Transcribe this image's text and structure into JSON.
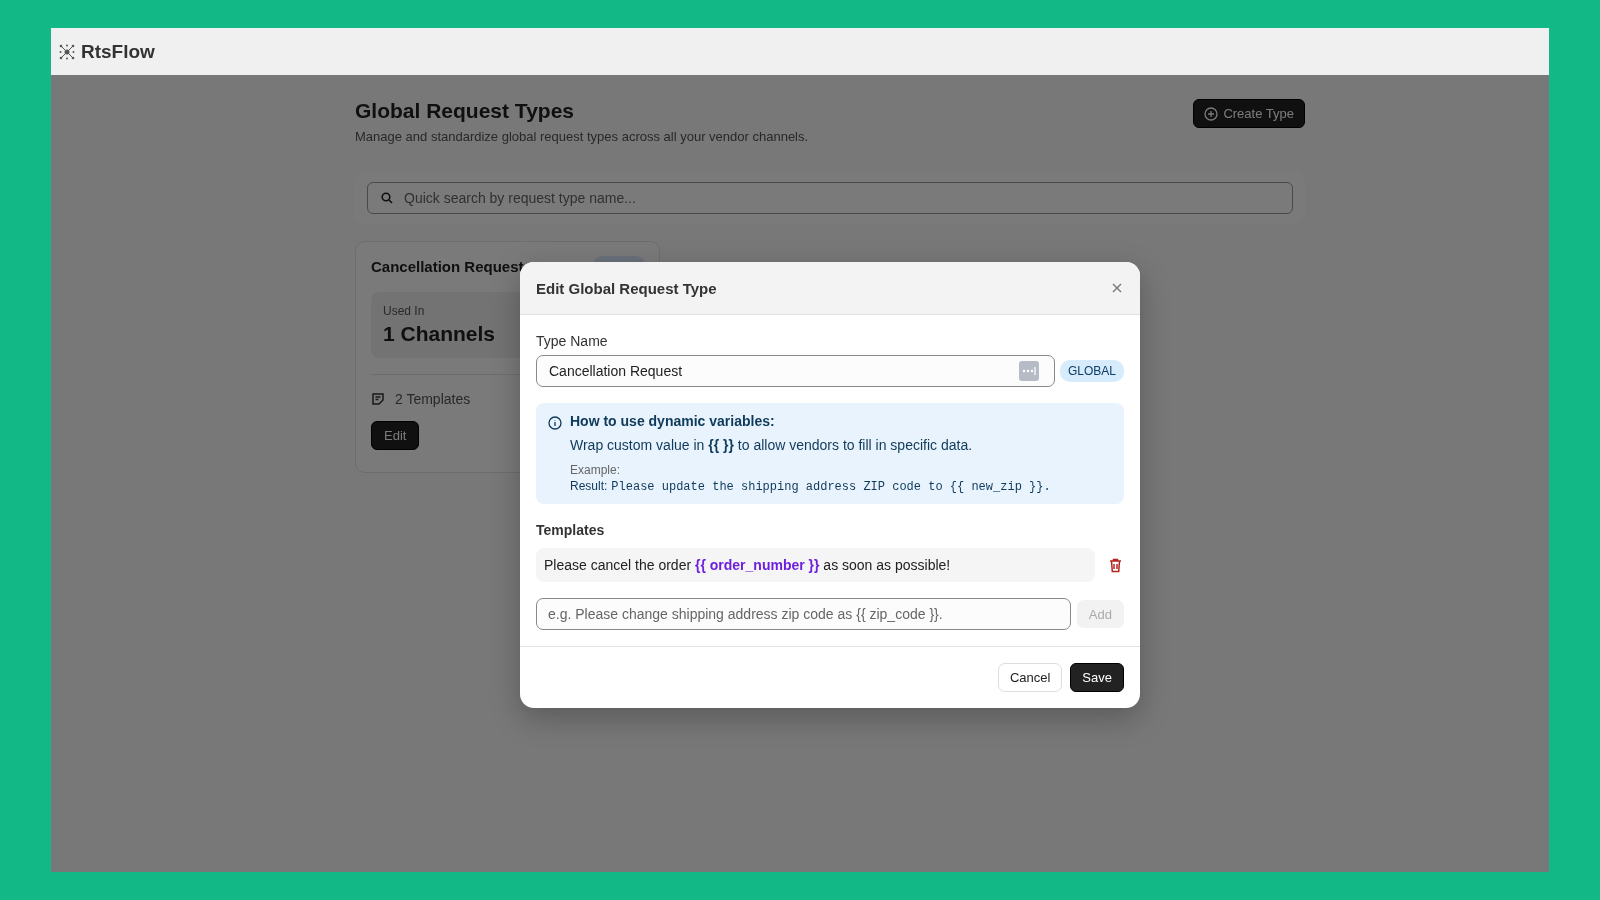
{
  "app": {
    "name": "RtsFlow"
  },
  "page": {
    "title": "Global Request Types",
    "subtitle": "Manage and standardize global request types across all your vendor channels.",
    "create_button": "Create Type",
    "search": {
      "placeholder": "Quick search by request type name..."
    }
  },
  "cards": [
    {
      "title": "Cancellation Request",
      "used_in_label": "Used In",
      "used_in_value": "1 Channels",
      "templates": "2 Templates",
      "edit_button": "Edit"
    }
  ],
  "dialog": {
    "title": "Edit Global Request Type",
    "type_name": {
      "label": "Type Name",
      "value": "Cancellation Request",
      "badge": "GLOBAL"
    },
    "info": {
      "heading": "How to use dynamic variables:",
      "text": "Wrap custom value in **{{ }}** to allow vendors to fill in specific data.",
      "example_label": "Example:",
      "result_label": "Result:",
      "result_text": "Please update the shipping address ZIP code to {{ new_zip }}."
    },
    "templates": {
      "label": "Templates",
      "items": [
        {
          "text": "Please cancel the order **{{ order_number }}** as soon as possible!"
        }
      ],
      "new_placeholder": "e.g. Please change shipping address zip code as {{ zip_code }}.",
      "add_button": "Add",
      "add_disabled": true
    },
    "buttons": {
      "cancel": "Cancel",
      "save": "Save"
    }
  }
}
